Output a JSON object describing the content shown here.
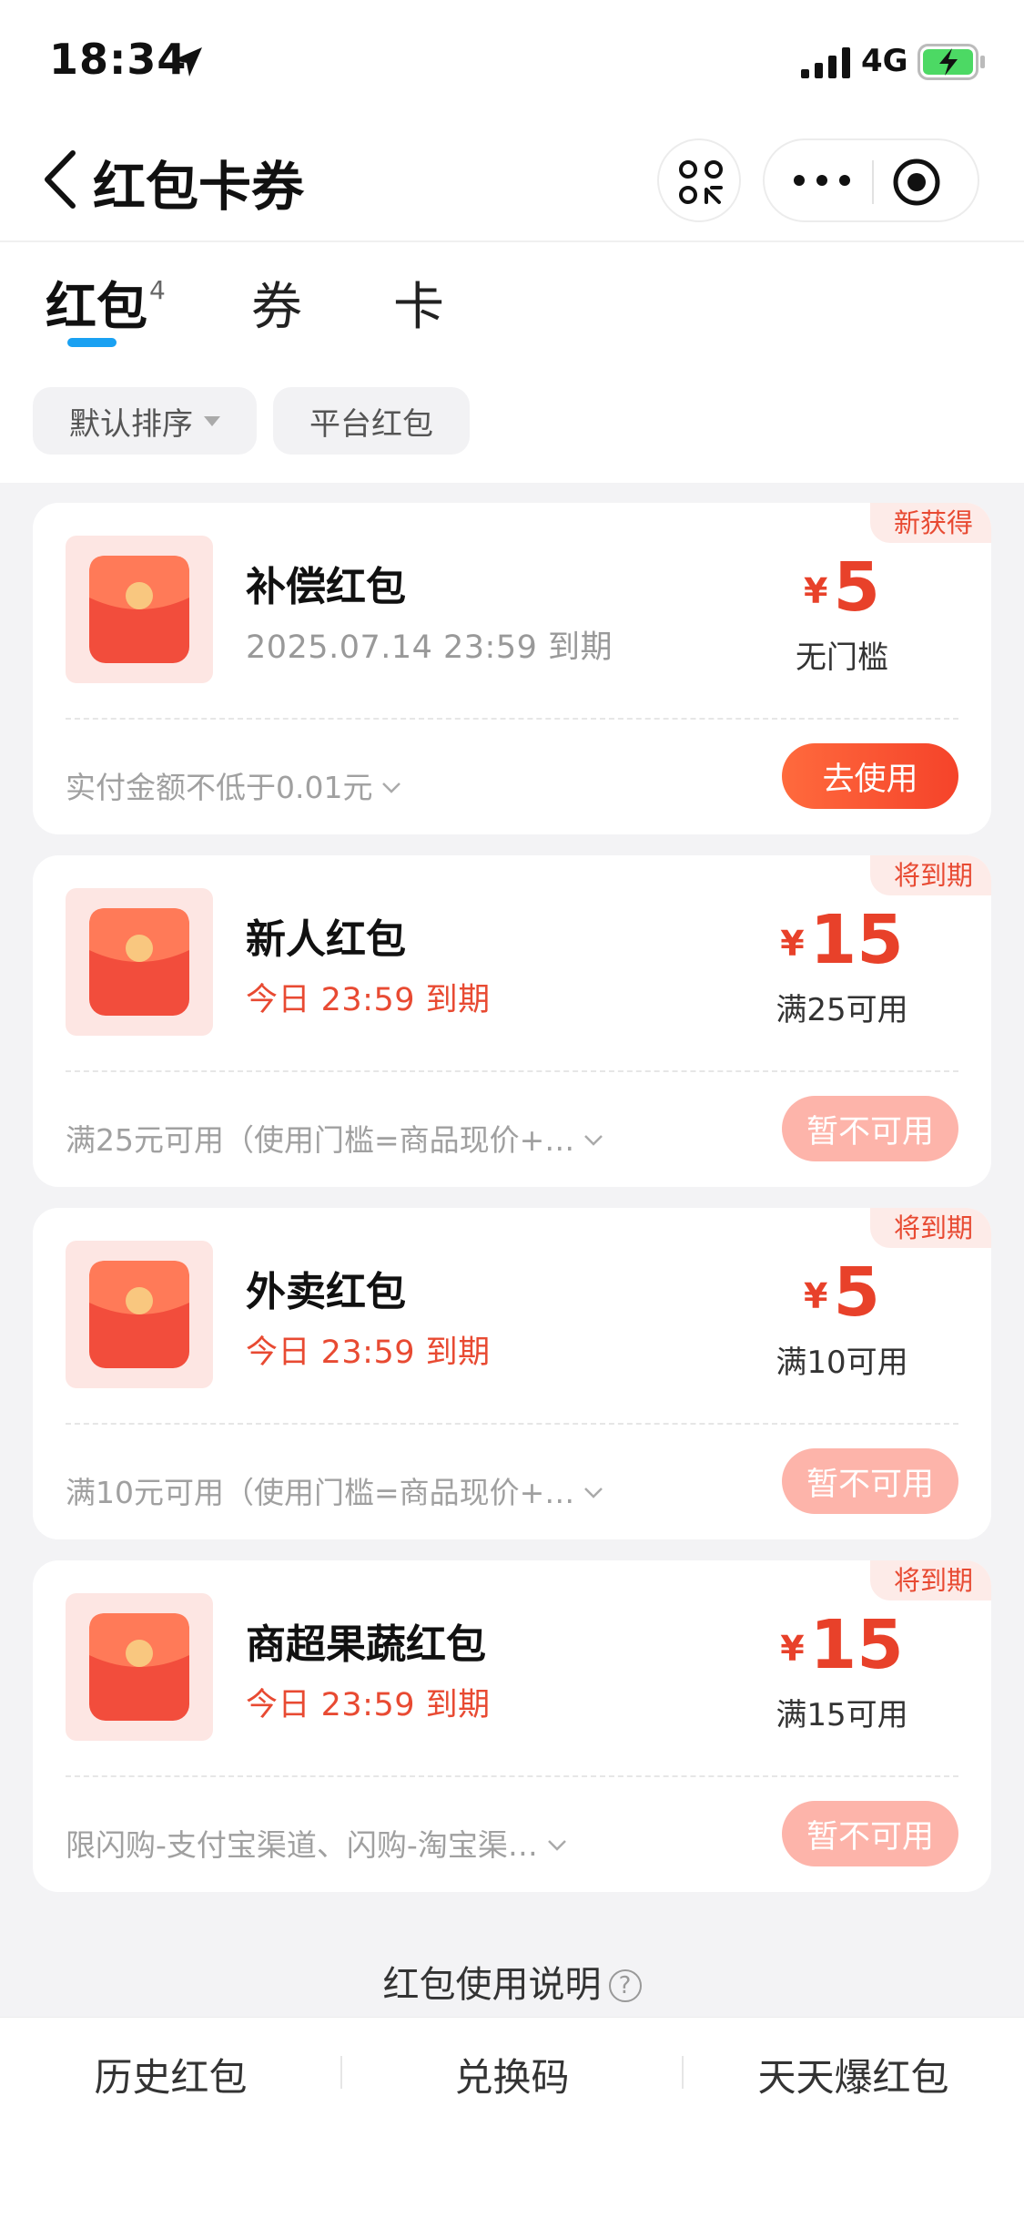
{
  "status_bar": {
    "time": "18:34",
    "network": "4G"
  },
  "nav": {
    "title": "红包卡券"
  },
  "tabs": [
    {
      "label": "红包",
      "count": "4"
    },
    {
      "label": "券"
    },
    {
      "label": "卡"
    }
  ],
  "filters": {
    "sort_label": "默认排序",
    "platform_label": "平台红包"
  },
  "currency_symbol": "¥",
  "cards": [
    {
      "badge": "新获得",
      "title": "补偿红包",
      "expiry": "2025.07.14 23:59 到期",
      "amount": "5",
      "condition": "无门槛",
      "rule": "实付金额不低于0.01元",
      "button": "去使用",
      "usable": true
    },
    {
      "badge": "将到期",
      "title": "新人红包",
      "expiry": "今日 23:59 到期",
      "amount": "15",
      "condition": "满25可用",
      "rule": "满25元可用（使用门槛=商品现价+…",
      "button": "暂不可用",
      "usable": false
    },
    {
      "badge": "将到期",
      "title": "外卖红包",
      "expiry": "今日 23:59 到期",
      "amount": "5",
      "condition": "满10可用",
      "rule": "满10元可用（使用门槛=商品现价+…",
      "button": "暂不可用",
      "usable": false
    },
    {
      "badge": "将到期",
      "title": "商超果蔬红包",
      "expiry": "今日 23:59 到期",
      "amount": "15",
      "condition": "满15可用",
      "rule": "限闪购-支付宝渠道、闪购-淘宝渠…",
      "button": "暂不可用",
      "usable": false
    }
  ],
  "help": {
    "label": "红包使用说明",
    "icon": "?"
  },
  "bottom_bar": {
    "history": "历史红包",
    "redeem": "兑换码",
    "daily": "天天爆红包"
  },
  "colors": {
    "accent_red": "#e8412a",
    "tab_underline": "#1aa1f2",
    "badge_bg": "#fdebe8",
    "disabled_button": "#fdb4aa"
  }
}
